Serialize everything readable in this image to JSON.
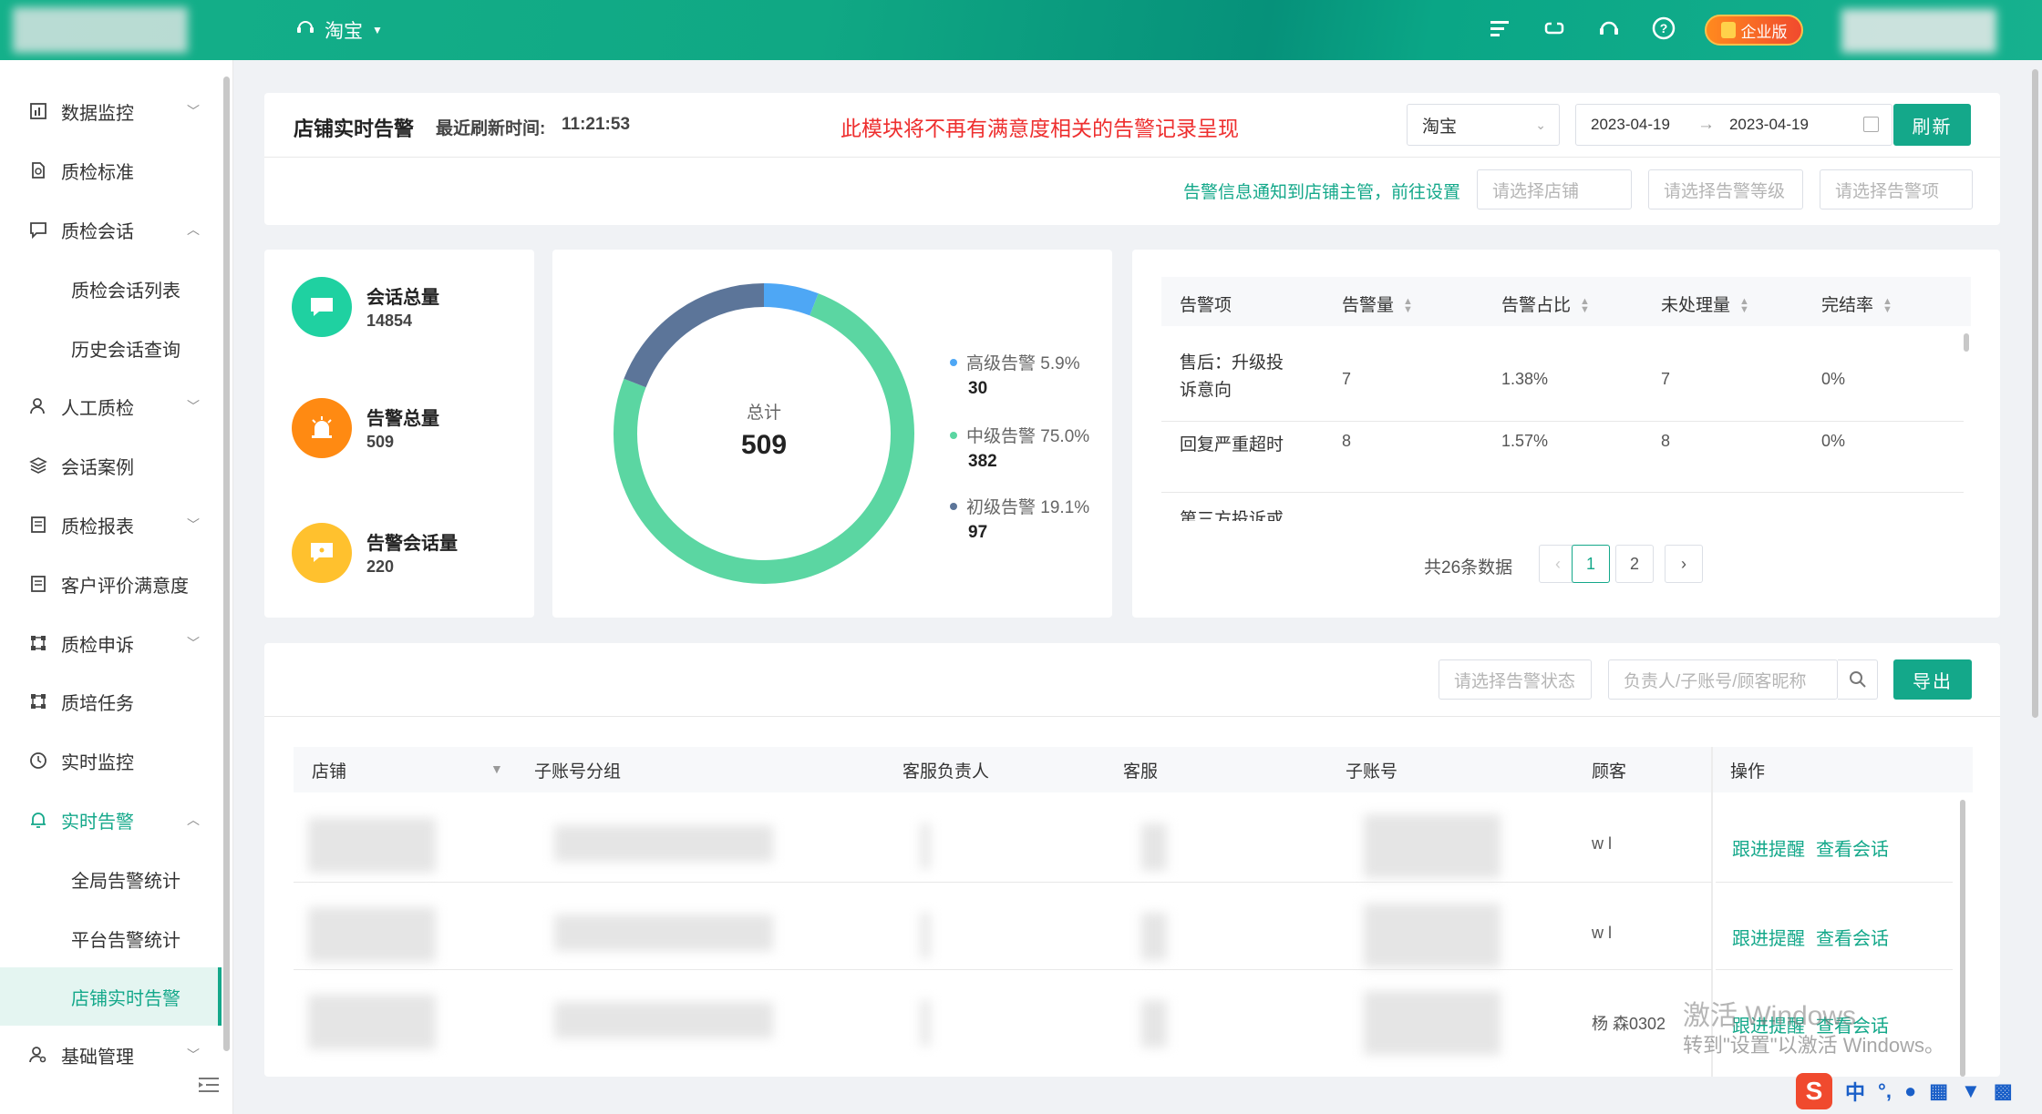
{
  "topbar": {
    "shop": "淘宝",
    "badge": "企业版",
    "icons": [
      "menu-icon",
      "refresh-cycle-icon",
      "headset-icon",
      "help-icon"
    ]
  },
  "sidebar": {
    "items": [
      {
        "label": "数据监控",
        "icon": "chart-icon",
        "expand": "down"
      },
      {
        "label": "质检标准",
        "icon": "document-search-icon"
      },
      {
        "label": "质检会话",
        "icon": "chat-icon",
        "expand": "up"
      },
      {
        "label": "质检会话列表",
        "sub": true
      },
      {
        "label": "历史会话查询",
        "sub": true
      },
      {
        "label": "人工质检",
        "icon": "user-icon",
        "expand": "down"
      },
      {
        "label": "会话案例",
        "icon": "layers-icon"
      },
      {
        "label": "质检报表",
        "icon": "report-icon",
        "expand": "down"
      },
      {
        "label": "客户评价满意度",
        "icon": "report-icon"
      },
      {
        "label": "质检申诉",
        "icon": "node-icon",
        "expand": "down"
      },
      {
        "label": "质培任务",
        "icon": "node-icon"
      },
      {
        "label": "实时监控",
        "icon": "clock-icon",
        "info": true
      },
      {
        "label": "实时告警",
        "icon": "bell-icon",
        "expand": "up",
        "green": true
      },
      {
        "label": "全局告警统计",
        "sub": true
      },
      {
        "label": "平台告警统计",
        "sub": true
      },
      {
        "label": "店铺实时告警",
        "sub": true,
        "active": true
      },
      {
        "label": "基础管理",
        "icon": "user-gear-icon",
        "info": true,
        "expand": "down"
      }
    ]
  },
  "header": {
    "title": "店铺实时告警",
    "refresh_label": "最近刷新时间:",
    "refresh_time": "11:21:53",
    "notice": "此模块将不再有满意度相关的告警记录呈现",
    "platform": "淘宝",
    "date_start": "2023-04-19",
    "date_sep": "→",
    "date_end": "2023-04-19",
    "refresh_btn": "刷新",
    "notify_link": "告警信息通知到店铺主管，前往设置",
    "shop_placeholder": "请选择店铺",
    "level_placeholder": "请选择告警等级",
    "item_placeholder": "请选择告警项"
  },
  "stats": [
    {
      "label": "会话总量",
      "value": "14854",
      "color": "#1fd1a1",
      "icon": "chat-bubble-icon"
    },
    {
      "label": "告警总量",
      "value": "509",
      "color": "#ff8a12",
      "icon": "alarm-icon"
    },
    {
      "label": "告警会话量",
      "value": "220",
      "color": "#ffc12e",
      "icon": "message-alert-icon"
    }
  ],
  "donut": {
    "center_label": "总计",
    "center_value": "509",
    "segments": [
      {
        "label": "高级告警 5.9%",
        "value": "30",
        "num": 30,
        "color": "#4ea7f5"
      },
      {
        "label": "中级告警 75.0%",
        "value": "382",
        "num": 382,
        "color": "#5bd6a2"
      },
      {
        "label": "初级告警 19.1%",
        "value": "97",
        "num": 97,
        "color": "#5c7599"
      }
    ]
  },
  "alarm_table": {
    "headers": [
      "告警项",
      "告警量",
      "告警占比",
      "未处理量",
      "完结率"
    ],
    "rows": [
      [
        "售后：升级投诉意向",
        "7",
        "1.38%",
        "7",
        "0%"
      ],
      [
        "回复严重超时",
        "8",
        "1.57%",
        "8",
        "0%"
      ],
      [
        "第三方投诉或",
        "",
        "",
        "",
        ""
      ]
    ],
    "total": "共26条数据",
    "pages": [
      "1",
      "2"
    ]
  },
  "detail": {
    "status_placeholder": "请选择告警状态",
    "search_placeholder": "负责人/子账号/顾客昵称",
    "export_btn": "导出",
    "headers": [
      "店铺",
      "子账号分组",
      "客服负责人",
      "客服",
      "子账号",
      "顾客",
      "操作"
    ],
    "rows": [
      {
        "customer": "w   l",
        "op1": "跟进提醒",
        "op2": "查看会话"
      },
      {
        "customer": "w   l",
        "op1": "跟进提醒",
        "op2": "查看会话"
      },
      {
        "customer": "杨   森0302",
        "op1": "跟进提醒",
        "op2": "查看会话"
      }
    ]
  },
  "watermark": {
    "line1": "激活 Windows",
    "line2": "转到\"设置\"以激活 Windows。"
  },
  "tray": {
    "ime": "中"
  }
}
